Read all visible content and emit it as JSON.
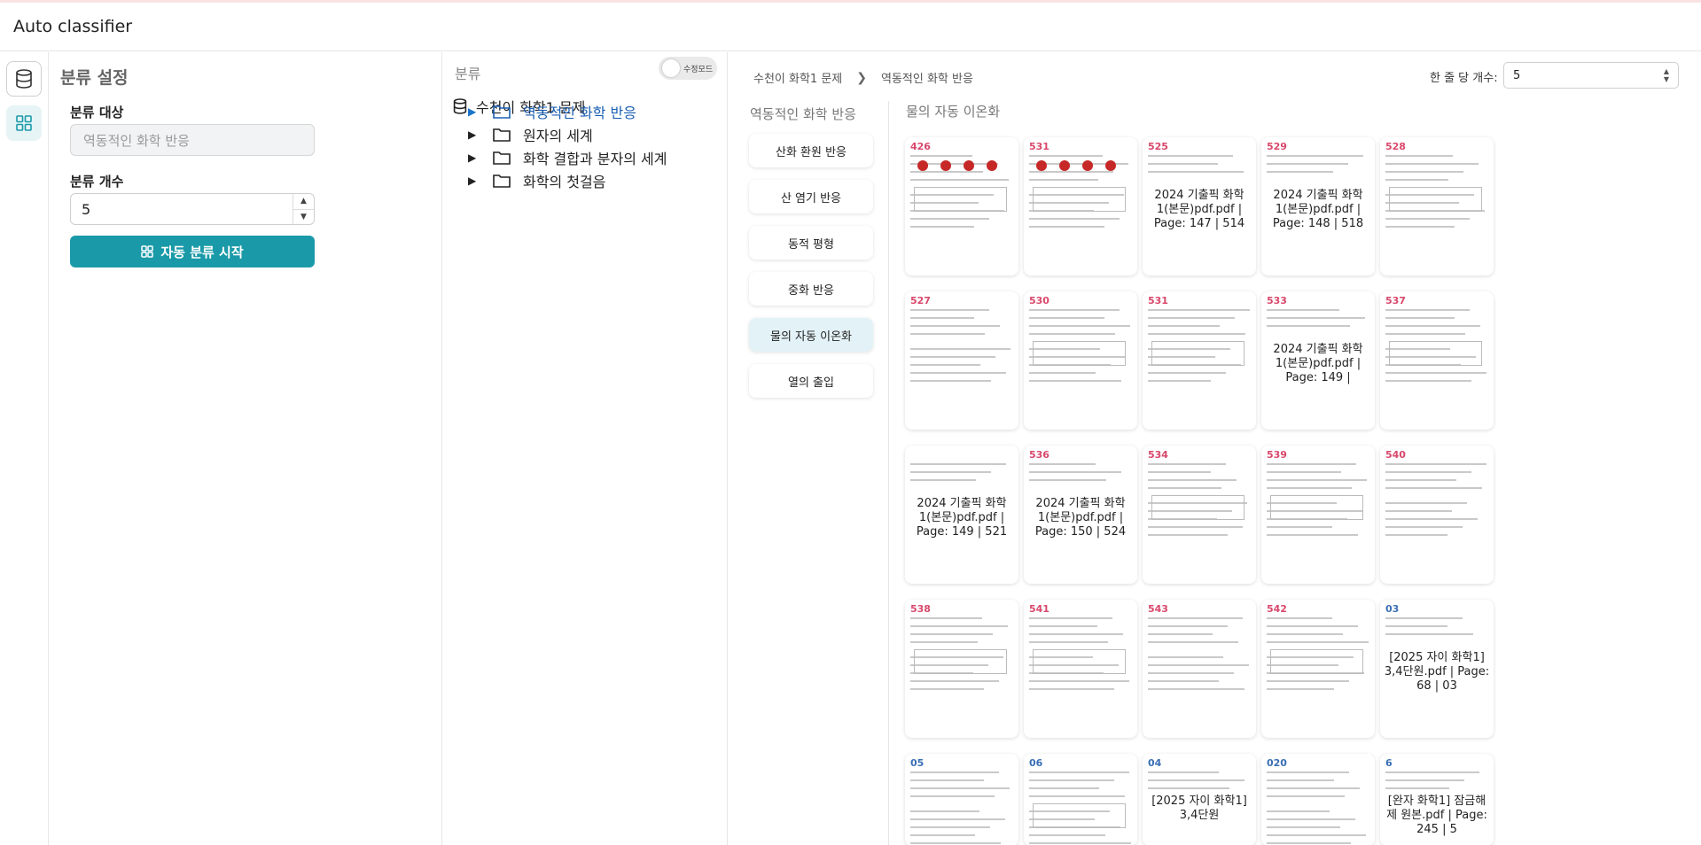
{
  "app": {
    "title": "Auto classifier"
  },
  "settings": {
    "title": "분류 설정",
    "target_label": "분류 대상",
    "target_placeholder": "역동적인 화학 반응",
    "count_label": "분류 개수",
    "count_value": "5",
    "start_button": "자동 분류 시작"
  },
  "tree": {
    "title": "분류",
    "mode_toggle": "수정모드",
    "root": "수천이 화학1 문제",
    "nodes": [
      {
        "label": "역동적인 화학 반응",
        "active": true
      },
      {
        "label": "원자의 세계",
        "active": false
      },
      {
        "label": "화학 결합과 분자의 세계",
        "active": false
      },
      {
        "label": "화학의 첫걸음",
        "active": false
      }
    ]
  },
  "breadcrumb": [
    "수천이 화학1 문제",
    "역동적인 화학 반응"
  ],
  "per_line": {
    "label": "한 줄 당 개수:",
    "value": "5"
  },
  "subtopics": {
    "title": "역동적인 화학 반응",
    "items": [
      "산화 환원 반응",
      "산 염기 반응",
      "동적 평형",
      "중화 반응",
      "물의 자동 이온화",
      "열의 출입"
    ],
    "active_index": 4
  },
  "grid": {
    "title": "물의 자동 이온화",
    "cards": [
      {
        "num": "426",
        "caption": ""
      },
      {
        "num": "531",
        "caption": ""
      },
      {
        "num": "525",
        "caption": "2024 기출픽 화학1(본문)pdf.pdf | Page: 147 | 514"
      },
      {
        "num": "529",
        "caption": "2024 기출픽 화학1(본문)pdf.pdf | Page: 148 | 518"
      },
      {
        "num": "528",
        "caption": ""
      },
      {
        "num": "527",
        "caption": ""
      },
      {
        "num": "530",
        "caption": ""
      },
      {
        "num": "531",
        "caption": ""
      },
      {
        "num": "533",
        "caption": "2024 기출픽 화학1(본문)pdf.pdf | Page: 149 |"
      },
      {
        "num": "537",
        "caption": ""
      },
      {
        "num": "",
        "caption": "2024 기출픽 화학1(본문)pdf.pdf | Page: 149 | 521"
      },
      {
        "num": "536",
        "caption": "2024 기출픽 화학1(본문)pdf.pdf | Page: 150 | 524"
      },
      {
        "num": "534",
        "caption": ""
      },
      {
        "num": "539",
        "caption": ""
      },
      {
        "num": "540",
        "caption": ""
      },
      {
        "num": "538",
        "caption": ""
      },
      {
        "num": "541",
        "caption": ""
      },
      {
        "num": "543",
        "caption": ""
      },
      {
        "num": "542",
        "caption": ""
      },
      {
        "num": "03",
        "caption": "[2025 자이 화학1] 3,4단원.pdf | Page: 68 | 03"
      },
      {
        "num": "05",
        "caption": ""
      },
      {
        "num": "06",
        "caption": ""
      },
      {
        "num": "04",
        "caption": "[2025 자이 화학1] 3,4단원"
      },
      {
        "num": "020",
        "caption": ""
      },
      {
        "num": "6",
        "caption": "[완자 화학1] 잠금해제 원본.pdf | Page: 245 | 5"
      }
    ]
  }
}
